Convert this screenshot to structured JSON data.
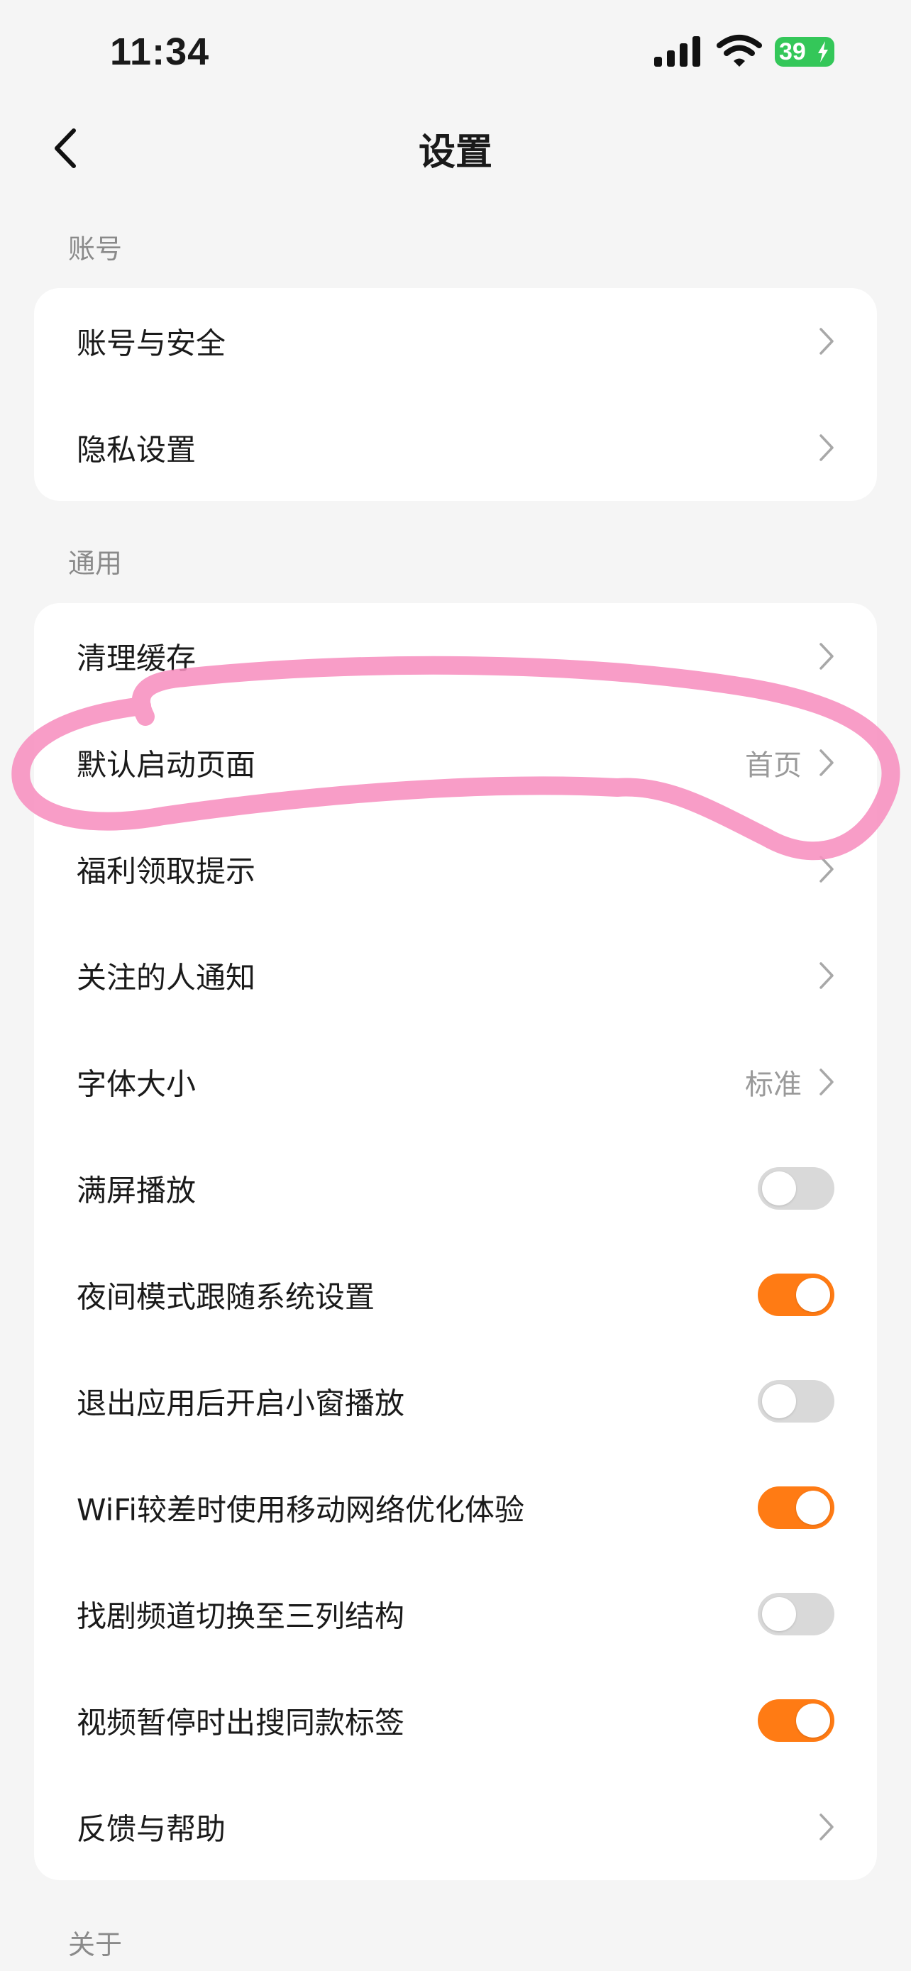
{
  "status_bar": {
    "time": "11:34",
    "battery": "39",
    "battery_color": "#34c759",
    "icons": [
      "signal-icon",
      "wifi-icon",
      "battery-icon"
    ]
  },
  "nav": {
    "title": "设置",
    "back_icon": "chevron-left-icon"
  },
  "sections": {
    "account": {
      "label": "账号",
      "items": [
        {
          "label": "账号与安全"
        },
        {
          "label": "隐私设置"
        }
      ]
    },
    "general": {
      "label": "通用",
      "items": [
        {
          "label": "清理缓存"
        },
        {
          "label": "默认启动页面",
          "value": "首页"
        },
        {
          "label": "福利领取提示"
        },
        {
          "label": "关注的人通知"
        },
        {
          "label": "字体大小",
          "value": "标准"
        },
        {
          "label": "满屏播放",
          "toggle": false
        },
        {
          "label": "夜间模式跟随系统设置",
          "toggle": true
        },
        {
          "label": "退出应用后开启小窗播放",
          "toggle": false
        },
        {
          "label": "WiFi较差时使用移动网络优化体验",
          "toggle": true
        },
        {
          "label": "找剧频道切换至三列结构",
          "toggle": false
        },
        {
          "label": "视频暂停时出搜同款标签",
          "toggle": true
        },
        {
          "label": "反馈与帮助"
        }
      ]
    },
    "about": {
      "label": "关于"
    }
  },
  "colors": {
    "toggle_on": "#ff7b14",
    "toggle_off": "#d9d9d9",
    "annotation": "#f78fbf"
  }
}
